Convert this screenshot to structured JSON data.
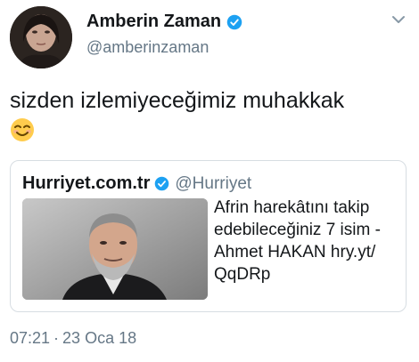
{
  "author": {
    "name": "Amberin Zaman",
    "handle": "@amberinzaman"
  },
  "tweet": {
    "text": "sizden izlemiyeceğimiz muhakkak",
    "emoji": "smiling-face-icon"
  },
  "quoted": {
    "name": "Hurriyet.com.tr",
    "handle": "@Hurriyet",
    "text": "Afrin harekâtını takip edebileceğiniz 7 isim - Ahmet HAKAN hry.yt/ QqDRp"
  },
  "meta": {
    "time": "07:21",
    "separator": "·",
    "date": "23 Oca 18"
  },
  "colors": {
    "verified": "#1da1f2",
    "text": "#14171a",
    "secondary": "#657786",
    "border": "#d7dde2"
  }
}
